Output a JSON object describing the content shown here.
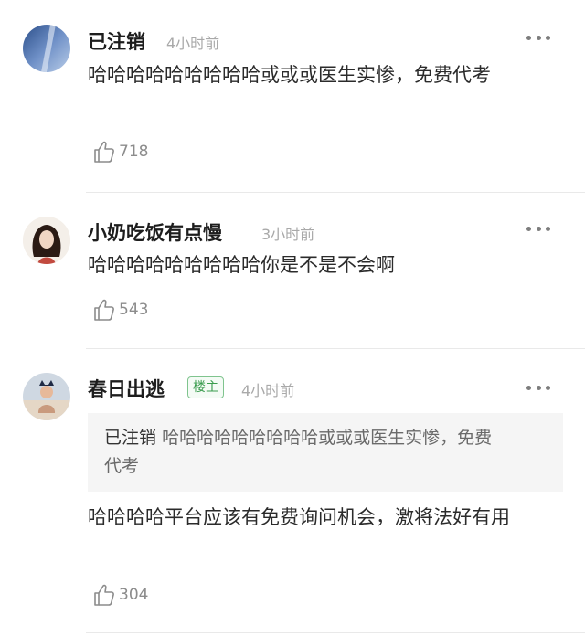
{
  "comments": [
    {
      "username": "已注销",
      "time": "4小时前",
      "text": "哈哈哈哈哈哈哈哈哈或或或医生实惨，免费代考",
      "likes": "718"
    },
    {
      "username": "小奶吃饭有点慢",
      "time": "3小时前",
      "text": "哈哈哈哈哈哈哈哈哈你是不是不会啊",
      "likes": "543"
    },
    {
      "username": "春日出逃",
      "badge": "楼主",
      "time": "4小时前",
      "quote_user": "已注销",
      "quote_text": "哈哈哈哈哈哈哈哈哈或或或医生实惨，免费代考",
      "text": "哈哈哈哈平台应该有免费询问机会，激将法好有用",
      "likes": "304"
    }
  ],
  "colors": {
    "badge_green": "#3a9c4e",
    "meta_gray": "#a9a9a9",
    "quote_bg": "#f5f5f5"
  },
  "icons": [
    "thumbs-up-icon",
    "more-options-icon"
  ]
}
